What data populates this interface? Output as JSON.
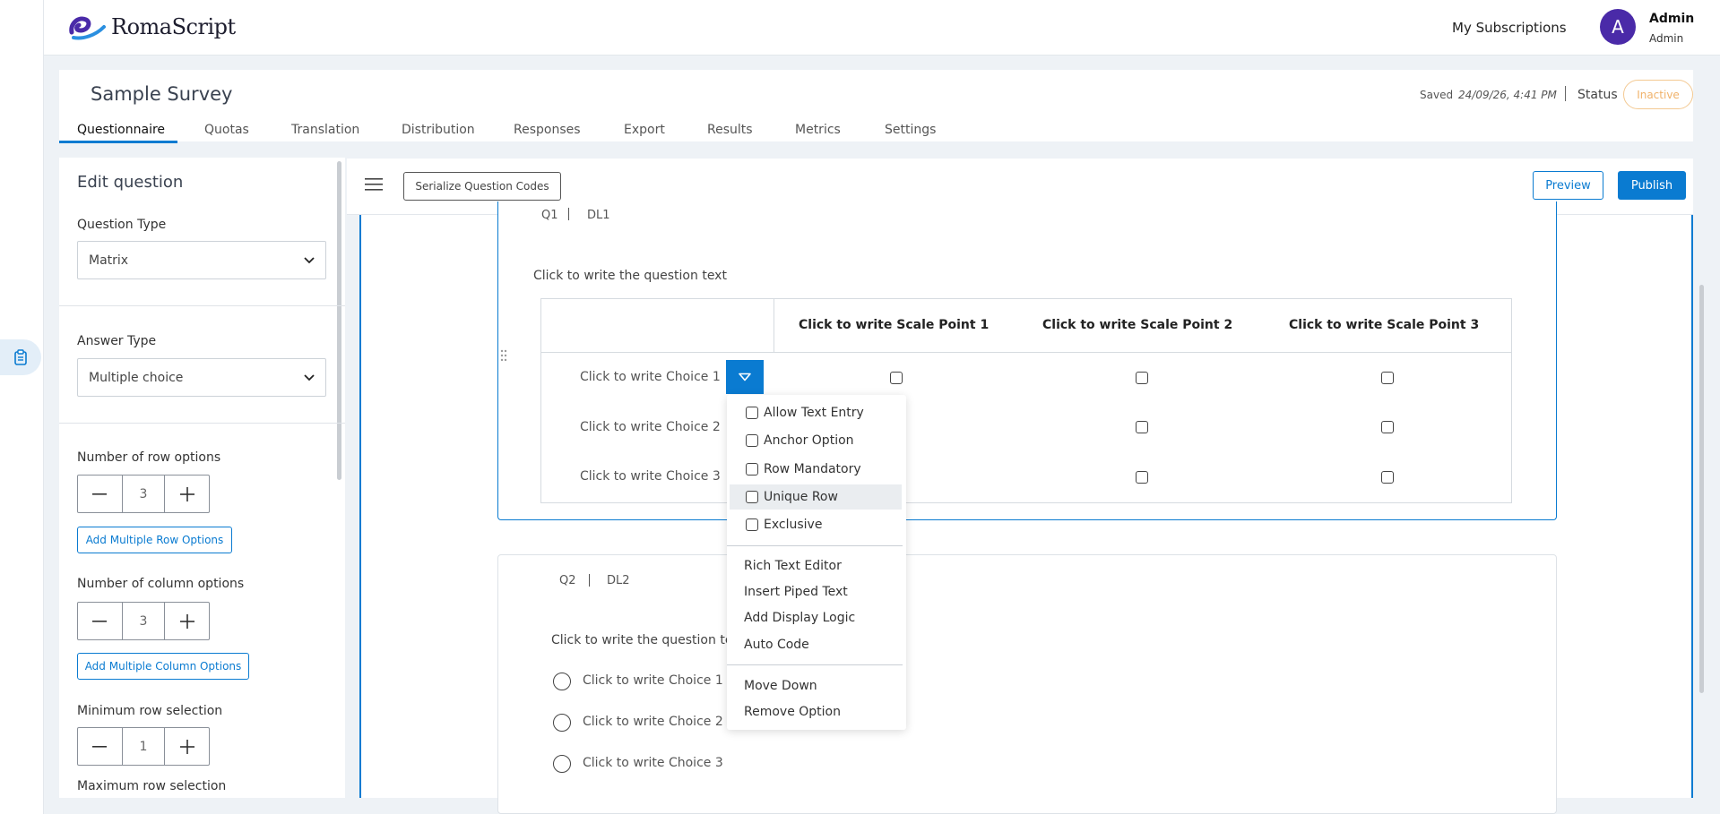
{
  "header": {
    "logo_text": "RomaScript",
    "my_subscriptions": "My Subscriptions",
    "avatar_initial": "A",
    "user_name": "Admin",
    "user_role": "Admin"
  },
  "survey": {
    "title": "Sample Survey",
    "saved_label": "Saved",
    "saved_time": "24/09/26, 4:41 PM",
    "status_label": "Status",
    "status_value": "Inactive",
    "status_color": "#f0b26a"
  },
  "tabs": [
    {
      "label": "Questionnaire",
      "active": true
    },
    {
      "label": "Quotas"
    },
    {
      "label": "Translation"
    },
    {
      "label": "Distribution"
    },
    {
      "label": "Responses"
    },
    {
      "label": "Export"
    },
    {
      "label": "Results"
    },
    {
      "label": "Metrics"
    },
    {
      "label": "Settings"
    }
  ],
  "edit_panel": {
    "title": "Edit question",
    "question_type_label": "Question Type",
    "question_type_value": "Matrix",
    "answer_type_label": "Answer Type",
    "answer_type_value": "Multiple choice",
    "row_options_label": "Number of row options",
    "row_options_value": "3",
    "add_row_options": "Add Multiple Row Options",
    "column_options_label": "Number of column options",
    "column_options_value": "3",
    "add_column_options": "Add Multiple Column Options",
    "min_row_label": "Minimum row selection",
    "min_row_value": "1",
    "max_row_label": "Maximum row selection"
  },
  "toolbar": {
    "serialize": "Serialize Question Codes",
    "preview": "Preview",
    "publish": "Publish"
  },
  "q1": {
    "code": "Q1",
    "display_logic": "DL1",
    "text": "Click to write the question text",
    "scale_points": [
      "Click to write Scale Point 1",
      "Click to write Scale Point 2",
      "Click to write Scale Point 3"
    ],
    "choices": [
      "Click to write Choice 1",
      "Click to write Choice 2",
      "Click to write Choice 3"
    ]
  },
  "row_menu": {
    "check_items": [
      "Allow Text Entry",
      "Anchor Option",
      "Row Mandatory",
      "Unique Row",
      "Exclusive"
    ],
    "highlighted": "Unique Row",
    "group2": [
      "Rich Text Editor",
      "Insert Piped Text",
      "Add Display Logic",
      "Auto Code"
    ],
    "group3": [
      "Move Down",
      "Remove Option"
    ]
  },
  "q2": {
    "code": "Q2",
    "display_logic": "DL2",
    "text": "Click to write the question text",
    "choices": [
      "Click to write Choice 1",
      "Click to write Choice 2",
      "Click to write Choice 3"
    ]
  },
  "colors": {
    "accent": "#0a7bd1",
    "avatar": "#4a2aa8"
  }
}
